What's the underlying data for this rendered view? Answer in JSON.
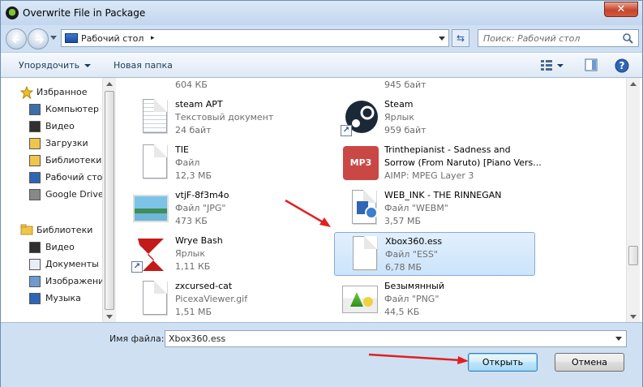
{
  "window": {
    "title": "Overwrite File in Package",
    "close_glyph": "✕"
  },
  "address": {
    "location": "Рабочий стол",
    "arrow": "▸",
    "search_placeholder": "Поиск: Рабочий стол",
    "refresh_glyph": "⇆"
  },
  "toolbar": {
    "organize": "Упорядочить",
    "new_folder": "Новая папка"
  },
  "nav": {
    "favorites_header": "Избранное",
    "favorites": [
      "Компьютер",
      "Видео",
      "Загрузки",
      "Библиотеки",
      "Рабочий сто",
      "Google Drive"
    ],
    "libraries_header": "Библиотеки",
    "libraries": [
      "Видео",
      "Документы",
      "Изображени",
      "Музыка"
    ]
  },
  "files": [
    {
      "name": "",
      "type": "",
      "size": "604 КБ",
      "icon": "partial-icon"
    },
    {
      "name": "",
      "type": "",
      "size": "945 байт",
      "icon": "shortcut-icon"
    },
    {
      "name": "steam APT",
      "type": "Текстовый документ",
      "size": "24 байт",
      "icon": "text-document-icon"
    },
    {
      "name": "Steam",
      "type": "Ярлык",
      "size": "959 байт",
      "icon": "steam-icon"
    },
    {
      "name": "TIE",
      "type": "Файл",
      "size": "12,3 МБ",
      "icon": "blank-file-icon"
    },
    {
      "name": "Trinthepianist - Sadness and",
      "name2": "Sorrow (From Naruto) [Piano Vers...",
      "type": "AIMP: MPEG Layer 3",
      "icon": "mp3-icon",
      "icon_text": "MP3"
    },
    {
      "name": "vtjF-8f3m4o",
      "type": "Файл \"JPG\"",
      "size": "473 КБ",
      "icon": "image-icon"
    },
    {
      "name": "WEB_INK - THE RINNEGAN",
      "type": "Файл \"WEBM\"",
      "size": "3,57 МБ",
      "icon": "video-file-icon"
    },
    {
      "name": "Wrye Bash",
      "type": "Ярлык",
      "size": "1,11 КБ",
      "icon": "wrye-bash-icon"
    },
    {
      "name": "Xbox360.ess",
      "type": "Файл \"ESS\"",
      "size": "6,78 МБ",
      "icon": "blank-file-icon",
      "selected": true
    },
    {
      "name": "zxcursed-cat",
      "type": "PicexaViewer.gif",
      "size": "1,51 МБ",
      "icon": "blank-file-icon"
    },
    {
      "name": "Безымянный",
      "type": "Файл \"PNG\"",
      "size": "44,5 КБ",
      "icon": "png-image-icon"
    }
  ],
  "bottom": {
    "filename_label": "Имя файла:",
    "filename_value": "Xbox360.ess",
    "open_label": "Открыть",
    "cancel_label": "Отмена"
  },
  "colors": {
    "annotation_arrow": "#e02020",
    "selection": "#cce4fb",
    "window_bg": "#cfe0f3"
  }
}
